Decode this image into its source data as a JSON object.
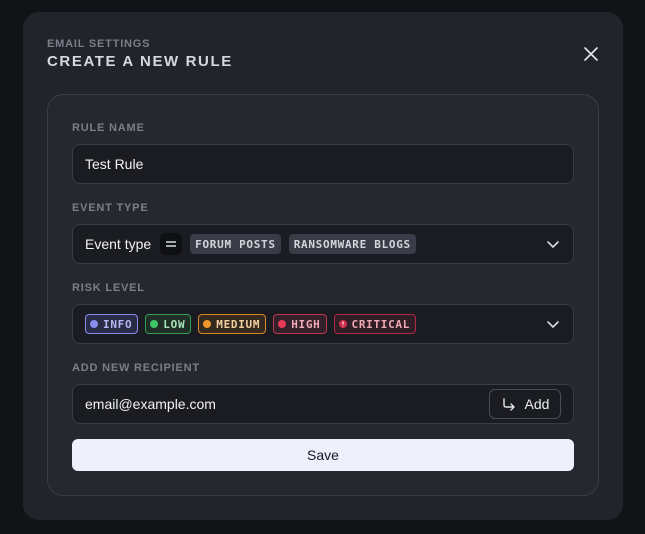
{
  "header": {
    "subtitle": "EMAIL SETTINGS",
    "title": "CREATE A NEW RULE"
  },
  "form": {
    "rule_name": {
      "label": "RULE NAME",
      "value": "Test Rule"
    },
    "event_type": {
      "label": "EVENT TYPE",
      "prefix": "Event type",
      "tags": [
        "FORUM POSTS",
        "RANSOMWARE BLOGS"
      ]
    },
    "risk_level": {
      "label": "RISK LEVEL",
      "levels": [
        {
          "label": "INFO",
          "color": "#8a8df0"
        },
        {
          "label": "LOW",
          "color": "#3fc46a"
        },
        {
          "label": "MEDIUM",
          "color": "#f0962e"
        },
        {
          "label": "HIGH",
          "color": "#e53b57"
        },
        {
          "label": "CRITICAL",
          "color": "#d12c48"
        }
      ]
    },
    "recipient": {
      "label": "ADD NEW RECIPIENT",
      "placeholder": "email@example.com",
      "add_label": "Add"
    },
    "save_label": "Save"
  }
}
